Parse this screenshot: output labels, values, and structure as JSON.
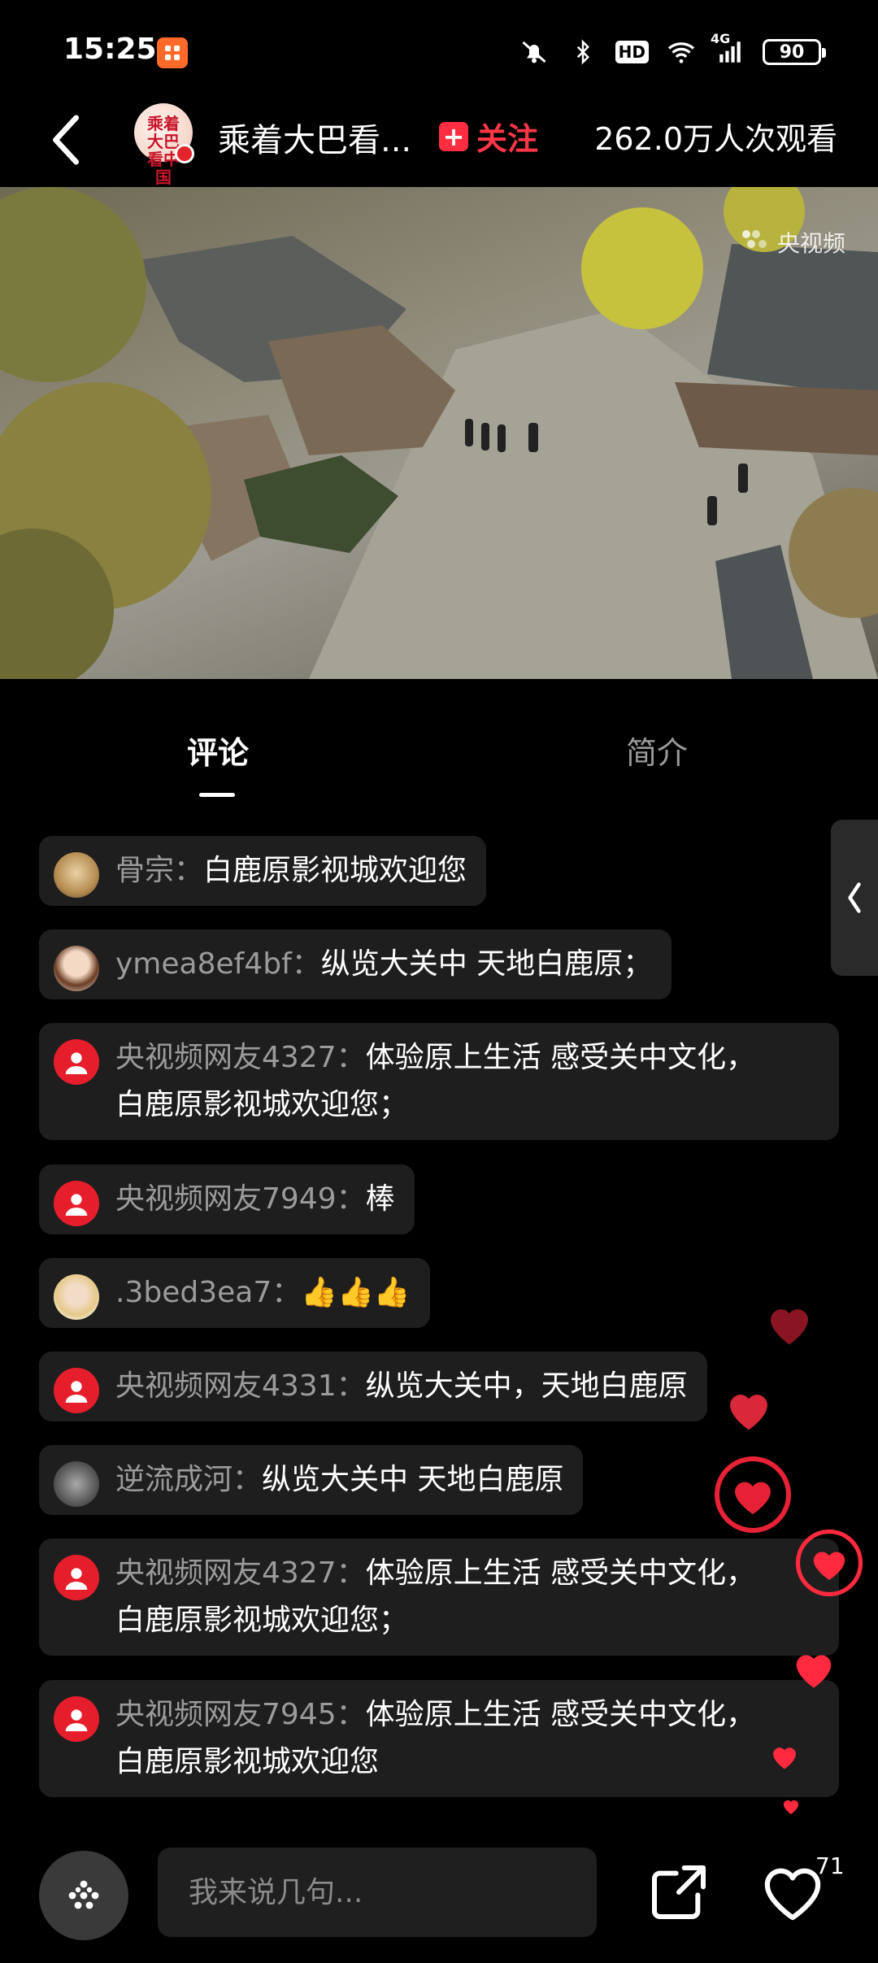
{
  "status_bar": {
    "time": "15:25",
    "app_badge_icon": "app-notification-icon",
    "battery": "90",
    "network": "4G",
    "hd_label": "HD"
  },
  "header": {
    "avatar_text": "乘着大巴看中国",
    "channel_name": "乘着大巴看...",
    "follow_label": "关注",
    "view_count": "262.0万人次观看"
  },
  "video": {
    "watermark": "央视频"
  },
  "tabs": {
    "comments": "评论",
    "intro": "简介"
  },
  "comments": [
    {
      "user": "骨宗：",
      "text": "白鹿原影视城欢迎您"
    },
    {
      "user": "ymea8ef4bf：",
      "text": "纵览大关中 天地白鹿原；"
    },
    {
      "user": "央视频网友4327：",
      "text": "体验原上生活 感受关中文化，",
      "text2": "白鹿原影视城欢迎您；"
    },
    {
      "user": "央视频网友7949：",
      "text": "棒"
    },
    {
      "user": ".3bed3ea7：",
      "text": "👍👍👍"
    },
    {
      "user": "央视频网友4331：",
      "text": "纵览大关中，天地白鹿原"
    },
    {
      "user": "逆流成河：",
      "text": "纵览大关中 天地白鹿原"
    },
    {
      "user": "央视频网友4327：",
      "text": "体验原上生活 感受关中文化，",
      "text2": "白鹿原影视城欢迎您；"
    },
    {
      "user": "央视频网友7945：",
      "text": "体验原上生活 感受关中文化，",
      "text2": "白鹿原影视城欢迎您"
    }
  ],
  "bottom_bar": {
    "input_placeholder": "我来说几句...",
    "like_count": "71"
  },
  "colors": {
    "accent_red": "#ff2d41",
    "background": "#000000",
    "bubble": "#1e1e1e",
    "username_grey": "#9b9b9b"
  }
}
